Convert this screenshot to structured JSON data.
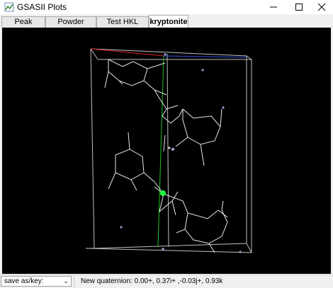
{
  "window": {
    "title": "GSASII Plots"
  },
  "tabs": [
    {
      "label": "Peak Widths"
    },
    {
      "label": "Powder Patterns"
    },
    {
      "label": "Test HKL phases"
    },
    {
      "label": "kryptonite",
      "active": true
    }
  ],
  "statusbar": {
    "save_label": "save as/key:",
    "message": "New quaternion: 0.00+, 0.37i+ ,-0.03j+, 0.93k"
  },
  "colors": {
    "plot_bg": "#000000",
    "bonds": "#e6e6e6",
    "cell": "#bfbfbf",
    "axis_x": "#d02020",
    "axis_y": "#20c020",
    "axis_z": "#3050e0",
    "highlight_atom": "#20ff40"
  }
}
